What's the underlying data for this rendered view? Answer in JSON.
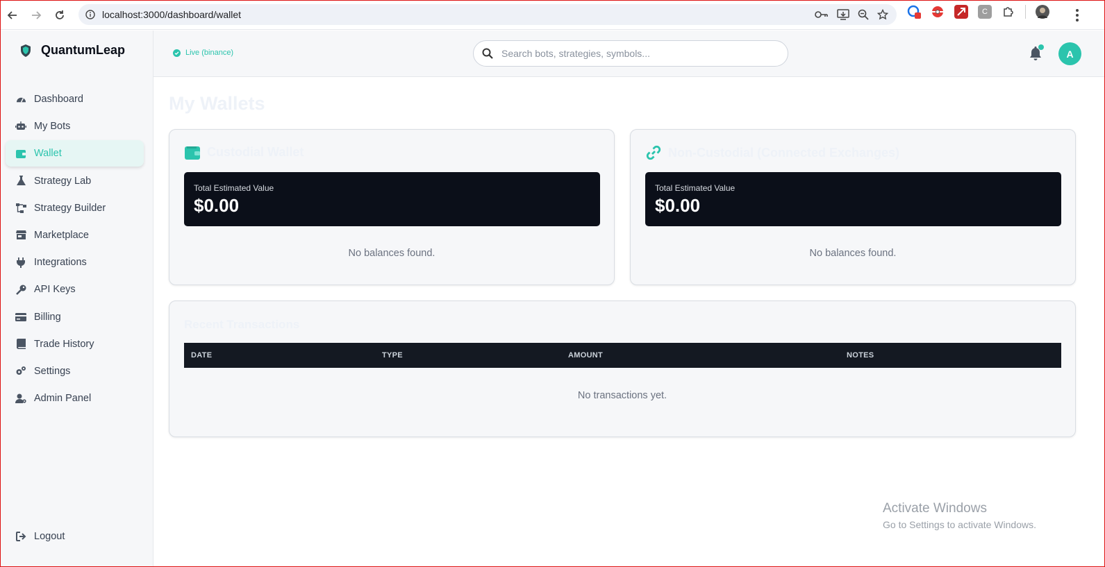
{
  "browser": {
    "url": "localhost:3000/dashboard/wallet"
  },
  "sidebar": {
    "brand": "QuantumLeap",
    "items": [
      {
        "label": "Dashboard",
        "icon": "gauge-icon"
      },
      {
        "label": "My Bots",
        "icon": "robot-icon"
      },
      {
        "label": "Wallet",
        "icon": "wallet-icon",
        "active": true
      },
      {
        "label": "Strategy Lab",
        "icon": "flask-icon"
      },
      {
        "label": "Strategy Builder",
        "icon": "diagram-icon"
      },
      {
        "label": "Marketplace",
        "icon": "store-icon"
      },
      {
        "label": "Integrations",
        "icon": "plug-icon"
      },
      {
        "label": "API Keys",
        "icon": "key-icon"
      },
      {
        "label": "Billing",
        "icon": "credit-card-icon"
      },
      {
        "label": "Trade History",
        "icon": "book-icon"
      },
      {
        "label": "Settings",
        "icon": "gears-icon"
      },
      {
        "label": "Admin Panel",
        "icon": "user-gear-icon"
      }
    ],
    "logout": "Logout"
  },
  "header": {
    "status": "Live (binance)",
    "search_placeholder": "Search bots, strategies, symbols...",
    "avatar_initial": "A"
  },
  "main": {
    "title": "My Wallets",
    "custodial": {
      "title": "Custodial Wallet",
      "value_label": "Total Estimated Value",
      "value": "$0.00",
      "empty": "No balances found."
    },
    "non_custodial": {
      "title": "Non-Custodial (Connected Exchanges)",
      "value_label": "Total Estimated Value",
      "value": "$0.00",
      "empty": "No balances found."
    },
    "transactions": {
      "title": "Recent Transactions",
      "columns": [
        "DATE",
        "TYPE",
        "AMOUNT",
        "NOTES"
      ],
      "empty": "No transactions yet."
    }
  },
  "watermark": {
    "line1": "Activate Windows",
    "line2": "Go to Settings to activate Windows."
  },
  "colors": {
    "accent": "#2bc4ad",
    "dark": "#0b0f19"
  }
}
